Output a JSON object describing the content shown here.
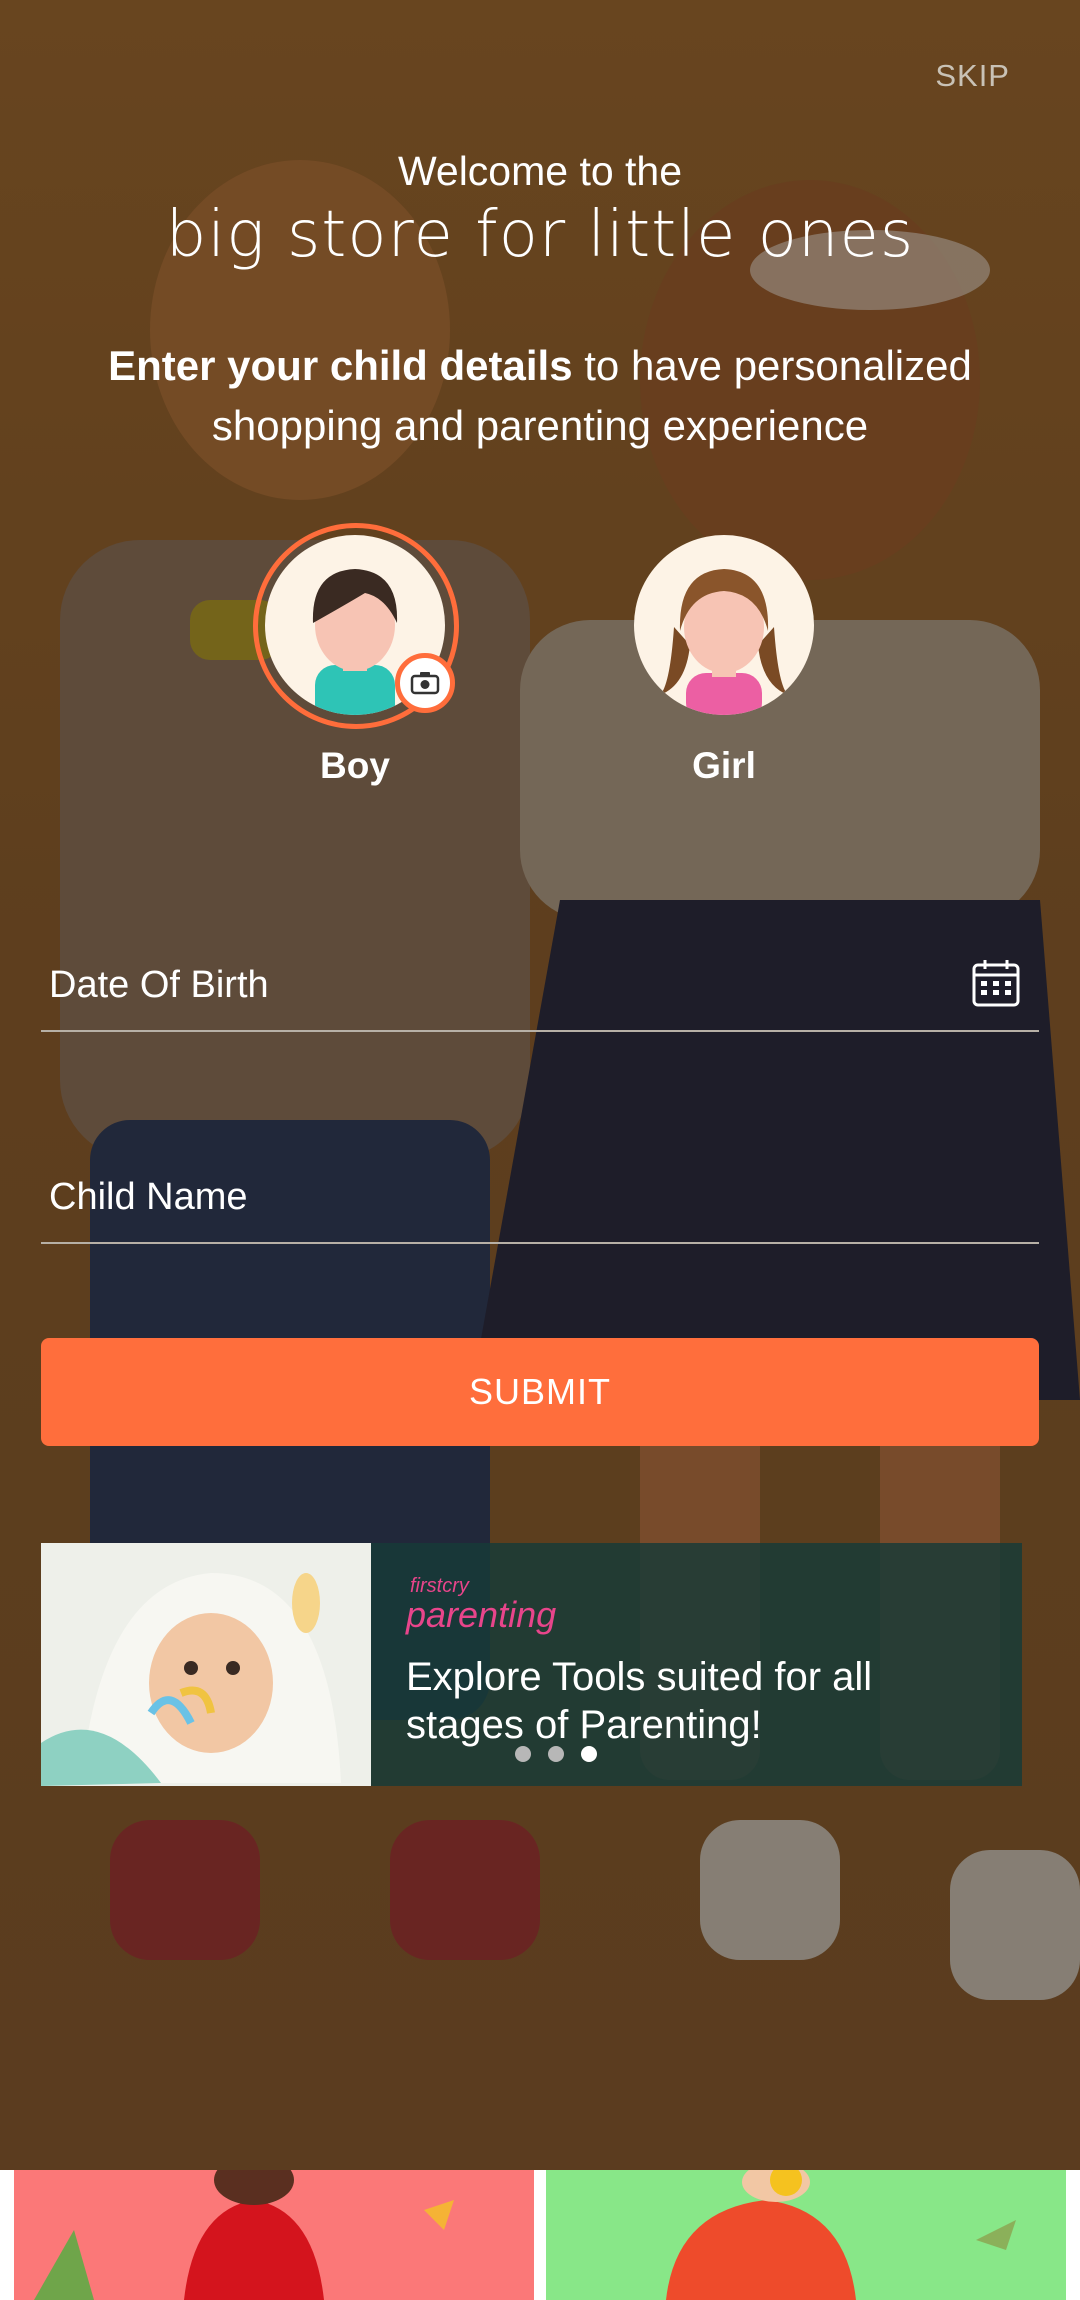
{
  "header": {
    "skip_label": "SKIP",
    "welcome": "Welcome to the",
    "tagline": "big store for little ones",
    "intro_bold": "Enter your child details",
    "intro_rest": " to have personalized shopping and parenting experience"
  },
  "gender": {
    "boy_label": "Boy",
    "girl_label": "Girl",
    "selected": "boy"
  },
  "form": {
    "dob_placeholder": "Date Of Birth",
    "name_placeholder": "Child Name",
    "submit_label": "SUBMIT"
  },
  "promo": {
    "brand_small": "firstcry",
    "brand_big": "parenting",
    "text": "Explore Tools suited for all stages of Parenting!",
    "active_dot": 2
  },
  "colors": {
    "accent": "#ff6e3c",
    "brand_pink": "#e8458b",
    "promo_bg": "#163a38"
  }
}
